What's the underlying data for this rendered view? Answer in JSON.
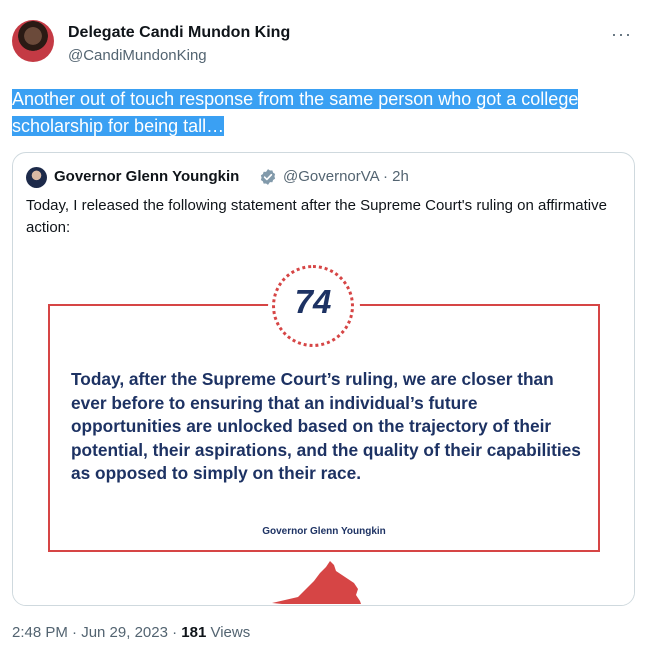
{
  "author": {
    "name": "Delegate Candi Mundon King",
    "handle": "@CandiMundonKing"
  },
  "tweet": {
    "text": "Another out of touch response from the same person who got a college scholarship for being tall…"
  },
  "quote": {
    "name": "Governor Glenn Youngkin",
    "handle_time": "@GovernorVA · 2h",
    "text": "Today, I released the following statement after the Supreme Court's ruling on affirmative action:",
    "image": {
      "badge": "74",
      "statement": "Today, after the Supreme Court’s ruling, we are closer than ever before to ensuring that an individual’s future opportunities are unlocked based on the trajectory of their potential, their aspirations, and the quality of their capabilities as opposed to simply on their race.",
      "signature": "Governor Glenn Youngkin"
    }
  },
  "meta": {
    "timestamp": "2:48 PM · Jun 29, 2023 · ",
    "views_count": "181",
    "views_label": " Views"
  },
  "icons": {
    "more": "more-horizontal-icon",
    "verified": "verified-badge-icon",
    "map": "virginia-map-icon"
  },
  "colors": {
    "highlight": "#3aa0f3",
    "statement_navy": "#1d3263",
    "accent_red": "#d64545",
    "verified_gray": "#829aab"
  }
}
